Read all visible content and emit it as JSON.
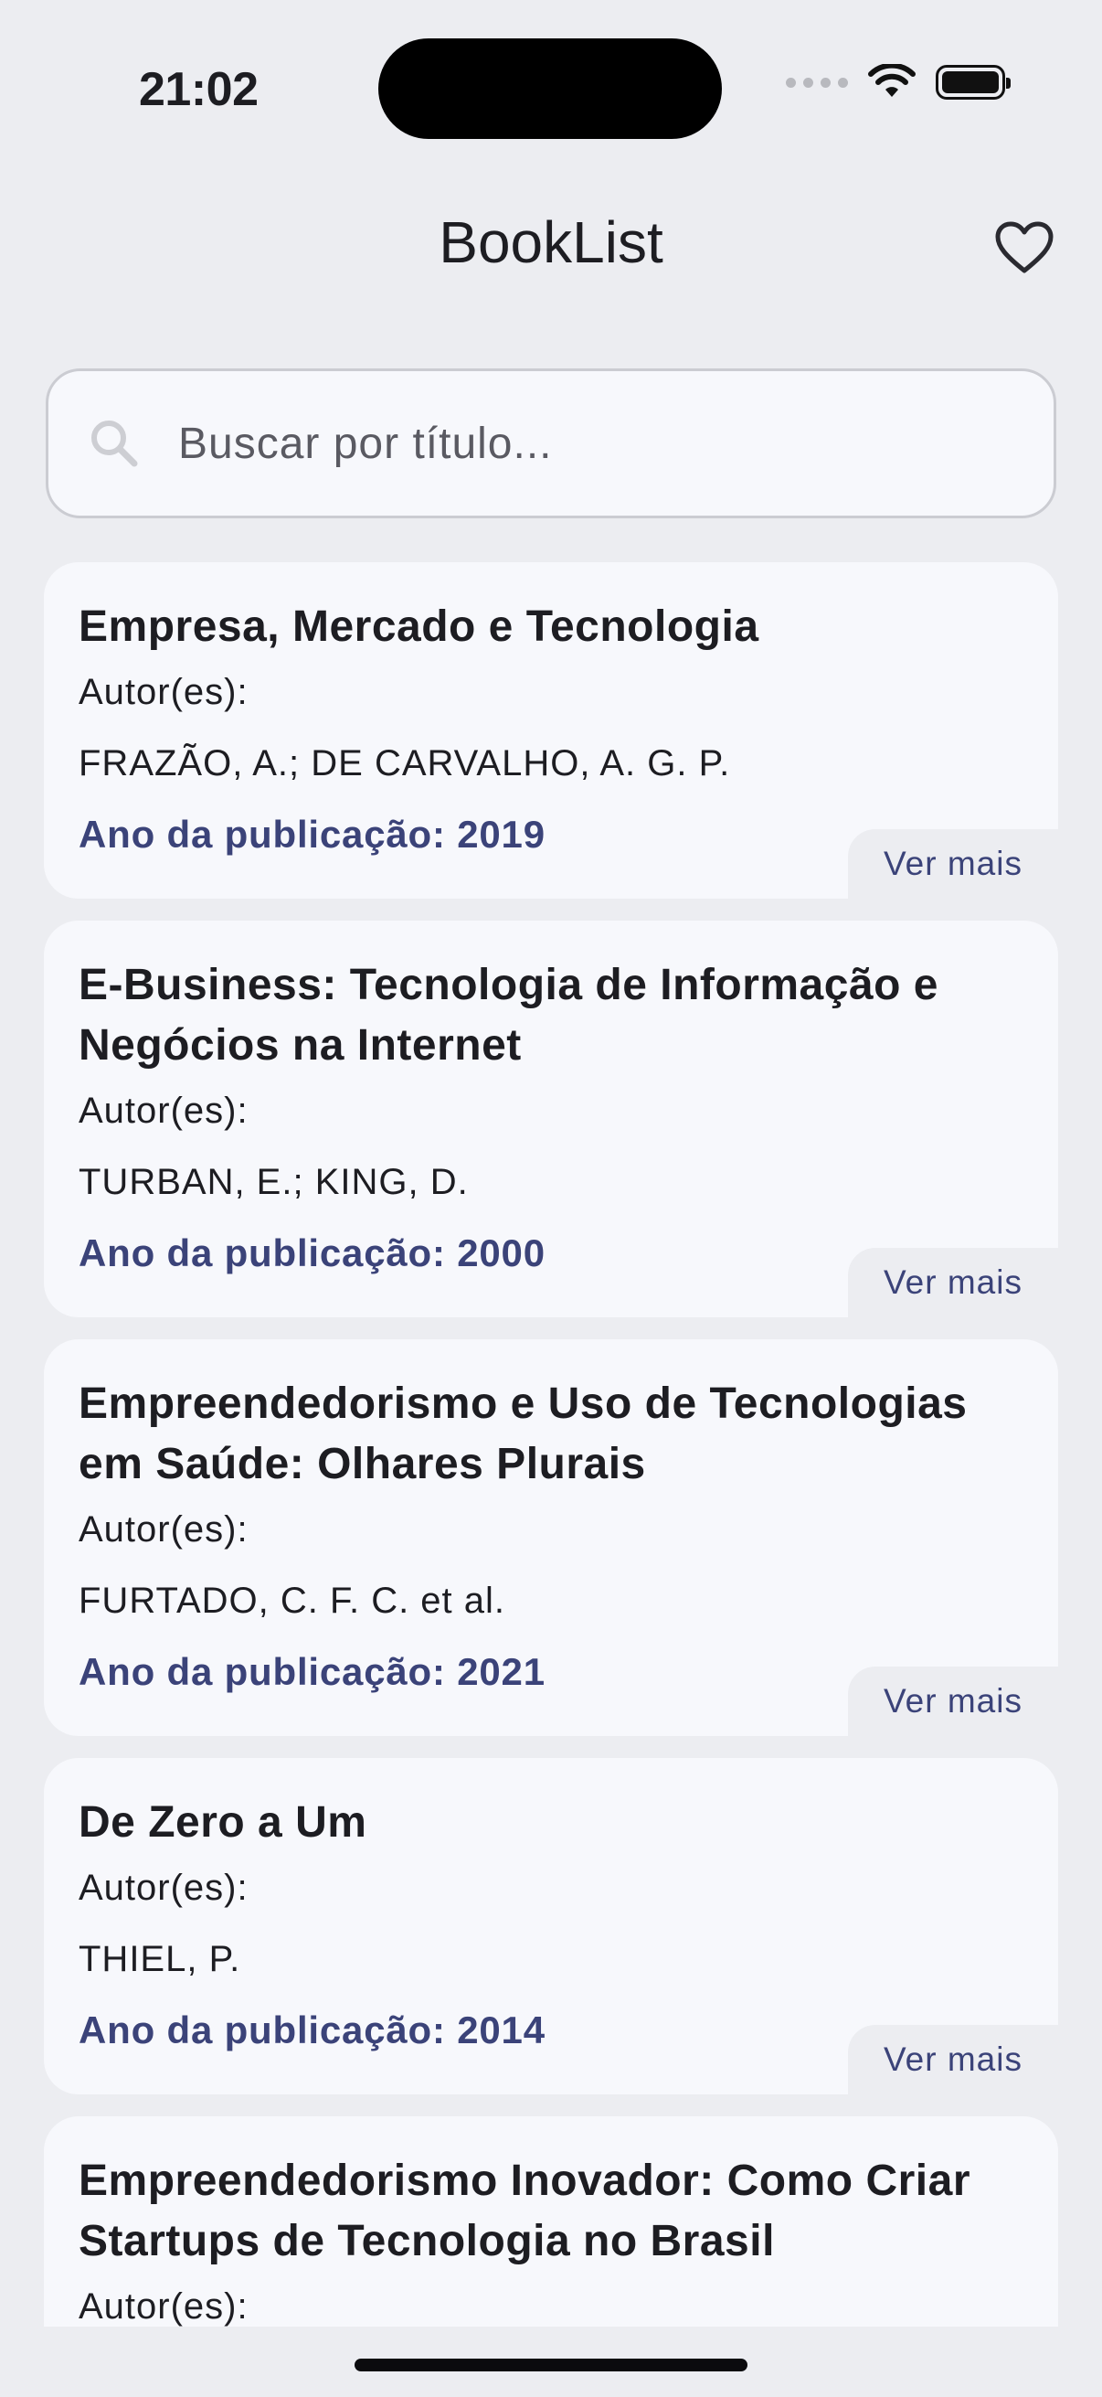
{
  "status_bar": {
    "time": "21:02"
  },
  "header": {
    "title": "BookList",
    "favorites_icon": "heart-outline-icon"
  },
  "search": {
    "placeholder": "Buscar por título...",
    "value": "",
    "icon": "search-icon"
  },
  "books": [
    {
      "title": "Empresa, Mercado e Tecnologia",
      "author_label": "Autor(es):",
      "authors": "FRAZÃO, A.; DE CARVALHO, A. G. P.",
      "year_text": "Ano da publicação: 2019",
      "more_label": "Ver mais"
    },
    {
      "title": "E-Business: Tecnologia de Informação e Negócios na Internet",
      "author_label": "Autor(es):",
      "authors": "TURBAN, E.; KING, D.",
      "year_text": "Ano da publicação: 2000",
      "more_label": "Ver mais"
    },
    {
      "title": "Empreendedorismo e Uso de Tecnologias em Saúde: Olhares Plurais",
      "author_label": "Autor(es):",
      "authors": "FURTADO, C. F. C. et al.",
      "year_text": "Ano da publicação: 2021",
      "more_label": "Ver mais"
    },
    {
      "title": "De Zero a Um",
      "author_label": "Autor(es):",
      "authors": "THIEL, P.",
      "year_text": "Ano da publicação: 2014",
      "more_label": "Ver mais"
    },
    {
      "title": "Empreendedorismo Inovador: Como Criar Startups de Tecnologia no Brasil",
      "author_label": "Autor(es):"
    }
  ],
  "colors": {
    "background": "#ECEDF1",
    "card": "#F7F8FC",
    "accent": "#3B4379",
    "text": "#1D1D22"
  }
}
